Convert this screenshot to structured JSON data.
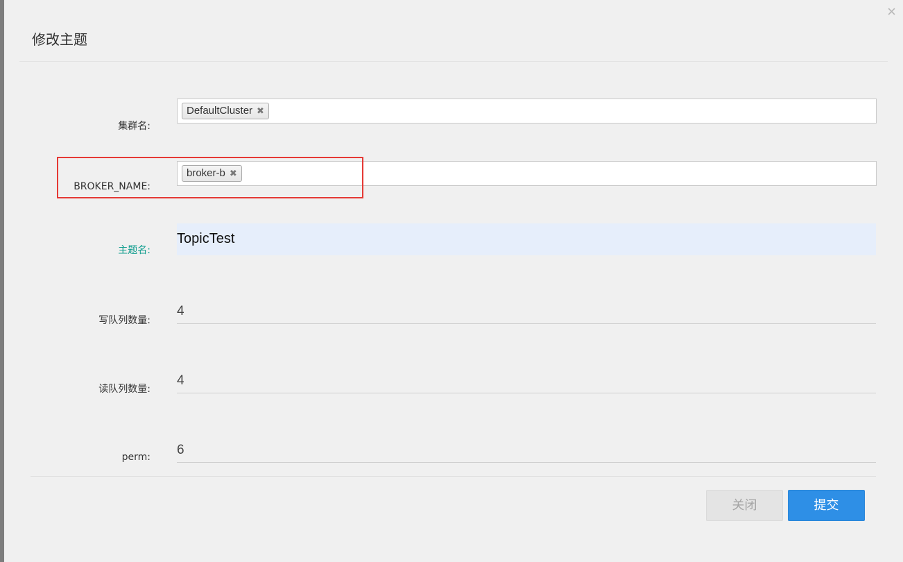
{
  "modal": {
    "title": "修改主题",
    "close_glyph": "×"
  },
  "form": {
    "cluster": {
      "label": "集群名:",
      "tags": [
        "DefaultCluster"
      ],
      "tag_remove_glyph": "✖"
    },
    "broker": {
      "label": "BROKER_NAME:",
      "tags": [
        "broker-b"
      ],
      "tag_remove_glyph": "✖"
    },
    "topic": {
      "label": "主题名:",
      "value": "TopicTest"
    },
    "write_queues": {
      "label": "写队列数量:",
      "value": "4"
    },
    "read_queues": {
      "label": "读队列数量:",
      "value": "4"
    },
    "perm": {
      "label": "perm:",
      "value": "6"
    }
  },
  "footer": {
    "close_label": "关闭",
    "submit_label": "提交"
  },
  "colors": {
    "highlight": "#e53935",
    "primary": "#2e8fe6",
    "accent_label": "#0f9d8e"
  }
}
